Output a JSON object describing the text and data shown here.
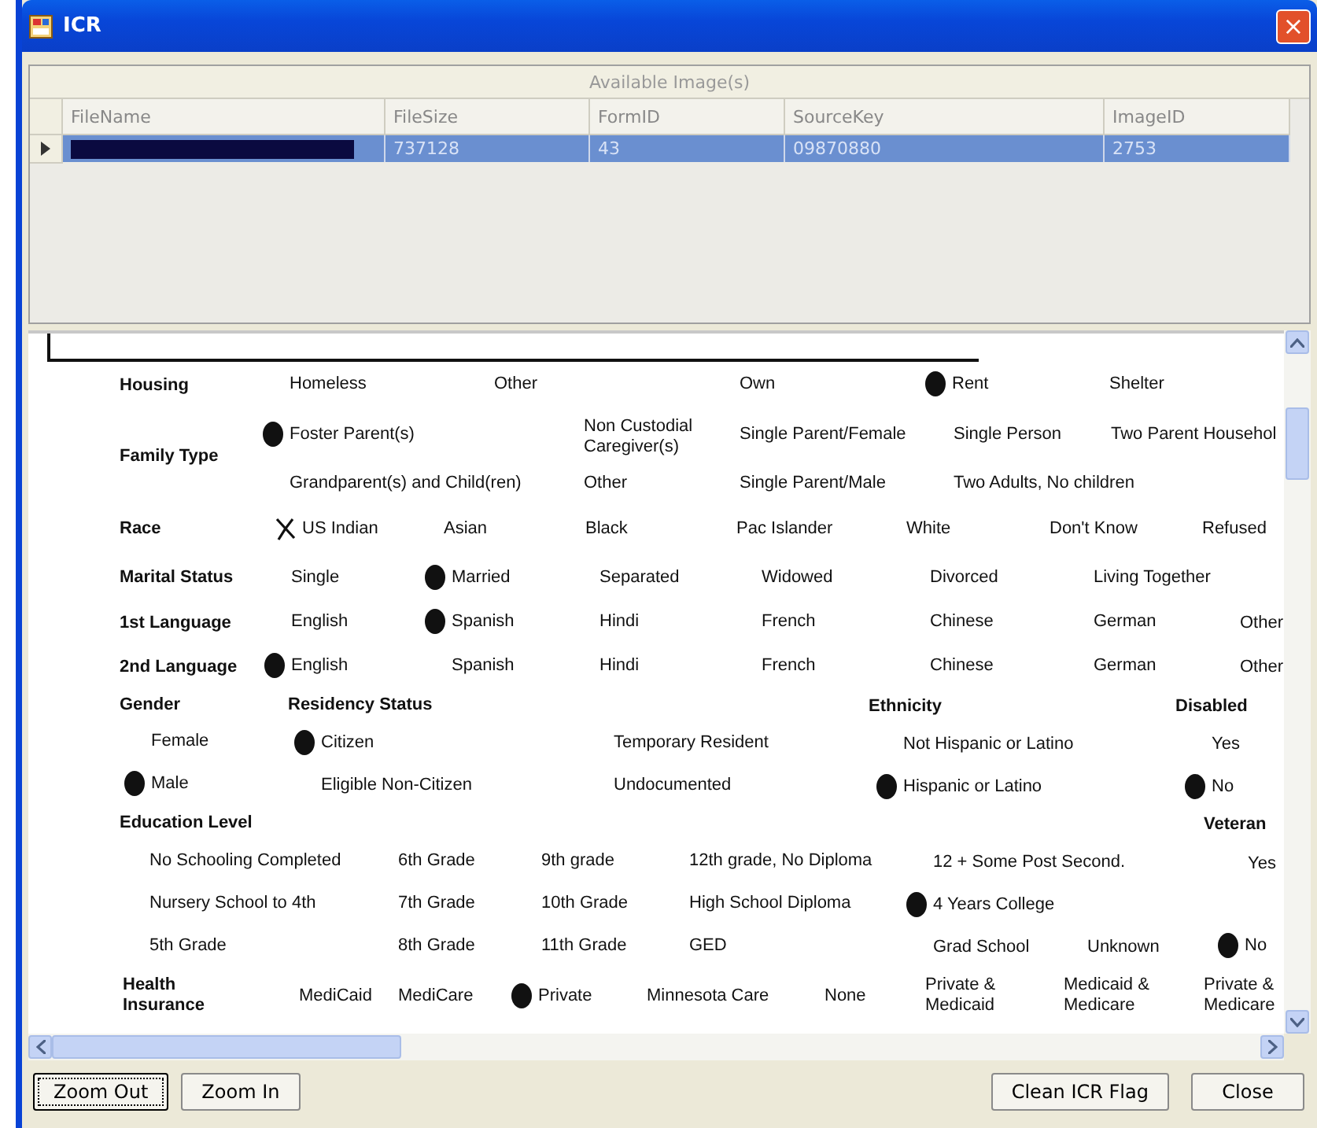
{
  "window": {
    "title": "ICR",
    "close_label": "×"
  },
  "images_grid": {
    "caption": "Available Image(s)",
    "columns": [
      "FileName",
      "FileSize",
      "FormID",
      "SourceKey",
      "ImageID"
    ],
    "rows": [
      {
        "selected": true,
        "filename_redacted": true,
        "cells": [
          "",
          "737128",
          "43",
          "09870880",
          "2753"
        ]
      }
    ]
  },
  "form": {
    "items": [
      {
        "kind": "label",
        "text": "Housing"
      },
      {
        "kind": "option",
        "text": "Homeless",
        "marked": false
      },
      {
        "kind": "option",
        "text": "Other",
        "marked": false
      },
      {
        "kind": "option",
        "text": "Own",
        "marked": false
      },
      {
        "kind": "option",
        "text": "Rent",
        "marked": true
      },
      {
        "kind": "option",
        "text": "Shelter",
        "marked": false
      },
      {
        "kind": "label",
        "text": "Family Type"
      },
      {
        "kind": "option",
        "text": "Foster Parent(s)",
        "marked": true
      },
      {
        "kind": "option",
        "text": "Non Custodial Caregiver(s)",
        "marked": false
      },
      {
        "kind": "option",
        "text": "Single Parent/Female",
        "marked": false
      },
      {
        "kind": "option",
        "text": "Single Person",
        "marked": false
      },
      {
        "kind": "option",
        "text": "Two Parent Househol",
        "marked": false
      },
      {
        "kind": "option",
        "text": "Grandparent(s) and Child(ren)",
        "marked": false
      },
      {
        "kind": "option",
        "text": "Other",
        "marked": false
      },
      {
        "kind": "option",
        "text": "Single Parent/Male",
        "marked": false
      },
      {
        "kind": "option",
        "text": "Two Adults, No children",
        "marked": false
      },
      {
        "kind": "label",
        "text": "Race"
      },
      {
        "kind": "crossed_option",
        "text": "US Indian",
        "marked": true
      },
      {
        "kind": "option",
        "text": "Asian",
        "marked": false
      },
      {
        "kind": "option",
        "text": "Black",
        "marked": false
      },
      {
        "kind": "option",
        "text": "Pac Islander",
        "marked": false
      },
      {
        "kind": "option",
        "text": "White",
        "marked": false
      },
      {
        "kind": "option",
        "text": "Don't Know",
        "marked": false
      },
      {
        "kind": "option",
        "text": "Refused",
        "marked": false
      },
      {
        "kind": "label",
        "text": "Marital Status"
      },
      {
        "kind": "option",
        "text": "Single",
        "marked": false
      },
      {
        "kind": "option",
        "text": "Married",
        "marked": true
      },
      {
        "kind": "option",
        "text": "Separated",
        "marked": false
      },
      {
        "kind": "option",
        "text": "Widowed",
        "marked": false
      },
      {
        "kind": "option",
        "text": "Divorced",
        "marked": false
      },
      {
        "kind": "option",
        "text": "Living Together",
        "marked": false
      },
      {
        "kind": "label",
        "text": "1st Language"
      },
      {
        "kind": "option",
        "text": "English",
        "marked": false
      },
      {
        "kind": "option",
        "text": "Spanish",
        "marked": true
      },
      {
        "kind": "option",
        "text": "Hindi",
        "marked": false
      },
      {
        "kind": "option",
        "text": "French",
        "marked": false
      },
      {
        "kind": "option",
        "text": "Chinese",
        "marked": false
      },
      {
        "kind": "option",
        "text": "German",
        "marked": false
      },
      {
        "kind": "option",
        "text": "Other",
        "marked": false
      },
      {
        "kind": "label",
        "text": "2nd Language"
      },
      {
        "kind": "option",
        "text": "English",
        "marked": true
      },
      {
        "kind": "option",
        "text": "Spanish",
        "marked": false
      },
      {
        "kind": "option",
        "text": "Hindi",
        "marked": false
      },
      {
        "kind": "option",
        "text": "French",
        "marked": false
      },
      {
        "kind": "option",
        "text": "Chinese",
        "marked": false
      },
      {
        "kind": "option",
        "text": "German",
        "marked": false
      },
      {
        "kind": "option",
        "text": "Other",
        "marked": false
      },
      {
        "kind": "label",
        "text": "Gender"
      },
      {
        "kind": "label",
        "text": "Residency Status"
      },
      {
        "kind": "label",
        "text": "Ethnicity"
      },
      {
        "kind": "label",
        "text": "Disabled"
      },
      {
        "kind": "option",
        "text": "Female",
        "marked": false
      },
      {
        "kind": "option",
        "text": "Citizen",
        "marked": true
      },
      {
        "kind": "option",
        "text": "Temporary Resident",
        "marked": false
      },
      {
        "kind": "option",
        "text": "Not Hispanic or Latino",
        "marked": false
      },
      {
        "kind": "option",
        "text": "Yes",
        "marked": false
      },
      {
        "kind": "option",
        "text": "Male",
        "marked": true
      },
      {
        "kind": "option",
        "text": "Eligible Non-Citizen",
        "marked": false
      },
      {
        "kind": "option",
        "text": "Undocumented",
        "marked": false
      },
      {
        "kind": "option",
        "text": "Hispanic or Latino",
        "marked": true
      },
      {
        "kind": "option",
        "text": "No",
        "marked": true
      },
      {
        "kind": "label",
        "text": "Education Level"
      },
      {
        "kind": "label",
        "text": "Veteran"
      },
      {
        "kind": "option",
        "text": "No Schooling Completed",
        "marked": false
      },
      {
        "kind": "option",
        "text": "6th Grade",
        "marked": false
      },
      {
        "kind": "option",
        "text": "9th grade",
        "marked": false
      },
      {
        "kind": "option",
        "text": "12th grade, No Diploma",
        "marked": false
      },
      {
        "kind": "option",
        "text": "12 + Some Post Second.",
        "marked": false
      },
      {
        "kind": "option",
        "text": "Yes",
        "marked": false
      },
      {
        "kind": "option",
        "text": "Nursery School to 4th",
        "marked": false
      },
      {
        "kind": "option",
        "text": "7th Grade",
        "marked": false
      },
      {
        "kind": "option",
        "text": "10th Grade",
        "marked": false
      },
      {
        "kind": "option",
        "text": "High School Diploma",
        "marked": false
      },
      {
        "kind": "option",
        "text": "4 Years College",
        "marked": true
      },
      {
        "kind": "option",
        "text": "5th Grade",
        "marked": false
      },
      {
        "kind": "option",
        "text": "8th Grade",
        "marked": false
      },
      {
        "kind": "option",
        "text": "11th Grade",
        "marked": false
      },
      {
        "kind": "option",
        "text": "GED",
        "marked": false
      },
      {
        "kind": "option",
        "text": "Grad School",
        "marked": false
      },
      {
        "kind": "option",
        "text": "Unknown",
        "marked": false
      },
      {
        "kind": "option",
        "text": "No",
        "marked": true
      },
      {
        "kind": "label",
        "text": "Health Insurance"
      },
      {
        "kind": "option",
        "text": "MediCaid",
        "marked": false
      },
      {
        "kind": "option",
        "text": "MediCare",
        "marked": false
      },
      {
        "kind": "option",
        "text": "Private",
        "marked": true
      },
      {
        "kind": "option",
        "text": "Minnesota Care",
        "marked": false
      },
      {
        "kind": "option",
        "text": "None",
        "marked": false
      },
      {
        "kind": "option",
        "text": "Private & Medicaid",
        "marked": false
      },
      {
        "kind": "option",
        "text": "Medicaid & Medicare",
        "marked": false
      },
      {
        "kind": "option",
        "text": "Private & Medicare",
        "marked": false
      }
    ]
  },
  "buttons": [
    {
      "label": "Zoom Out",
      "focused": true
    },
    {
      "label": "Zoom In",
      "focused": false
    },
    {
      "label": "Clean ICR Flag",
      "focused": false
    },
    {
      "label": "Close",
      "focused": false
    }
  ]
}
